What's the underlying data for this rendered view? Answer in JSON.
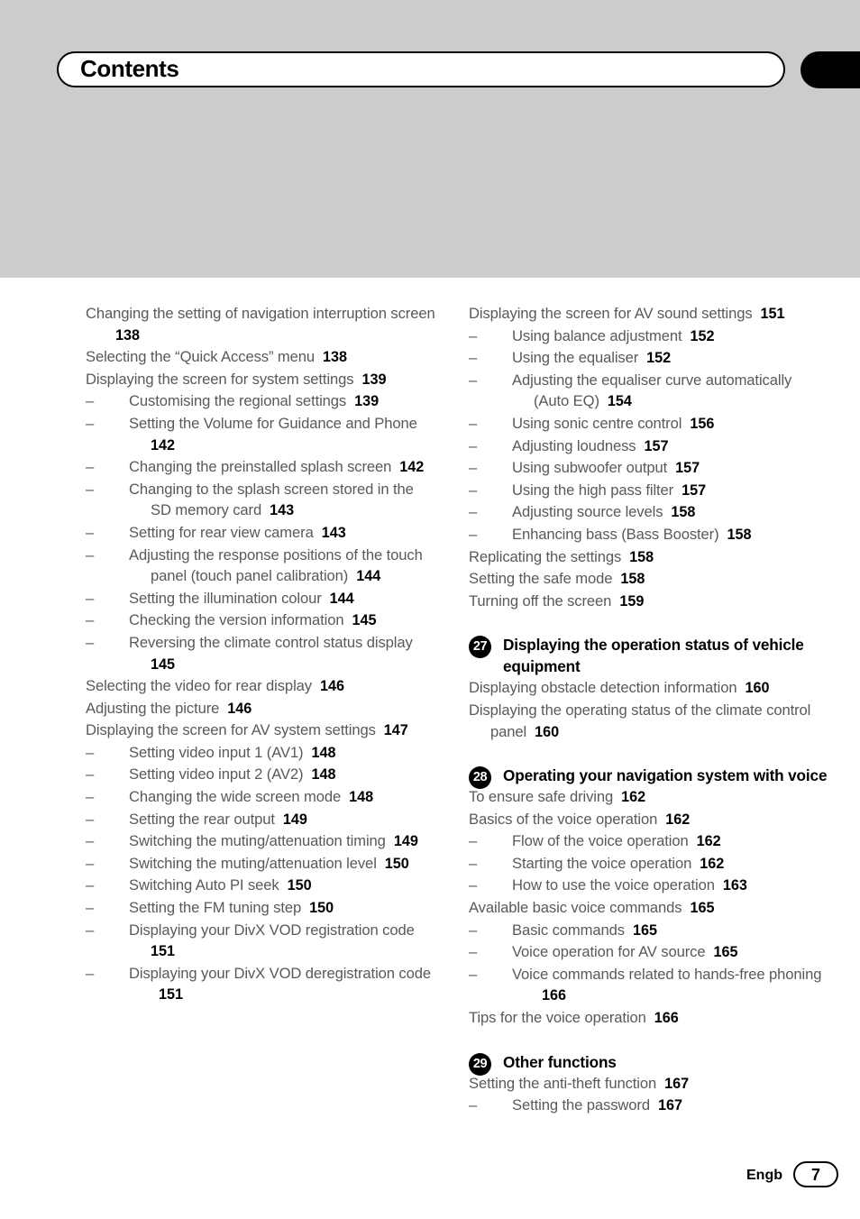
{
  "header": {
    "title": "Contents",
    "tab_icon": "black-edge-tab"
  },
  "footer": {
    "language_code": "Engb",
    "page_number": "7"
  },
  "columns": {
    "left": [
      {
        "level": 1,
        "text": "Changing the setting of navigation interruption screen",
        "page": "138"
      },
      {
        "level": 1,
        "text": "Selecting the “Quick Access” menu",
        "page": "138"
      },
      {
        "level": 1,
        "text": "Displaying the screen for system settings",
        "page": "139"
      },
      {
        "level": 2,
        "text": "Customising the regional settings",
        "page": "139"
      },
      {
        "level": 2,
        "text": "Setting the Volume for Guidance and Phone",
        "page": "142"
      },
      {
        "level": 2,
        "text": "Changing the preinstalled splash screen",
        "page": "142"
      },
      {
        "level": 2,
        "text": "Changing to the splash screen stored in the SD memory card",
        "page": "143"
      },
      {
        "level": 2,
        "text": "Setting for rear view camera",
        "page": "143"
      },
      {
        "level": 2,
        "text": "Adjusting the response positions of the touch panel (touch panel calibration)",
        "page": "144"
      },
      {
        "level": 2,
        "text": "Setting the illumination colour",
        "page": "144"
      },
      {
        "level": 2,
        "text": "Checking the version information",
        "page": "145"
      },
      {
        "level": 2,
        "text": "Reversing the climate control status display",
        "page": "145"
      },
      {
        "level": 1,
        "text": "Selecting the video for rear display",
        "page": "146"
      },
      {
        "level": 1,
        "text": "Adjusting the picture",
        "page": "146"
      },
      {
        "level": 1,
        "text": "Displaying the screen for AV system settings",
        "page": "147"
      },
      {
        "level": 2,
        "text": "Setting video input 1 (AV1)",
        "page": "148"
      },
      {
        "level": 2,
        "text": "Setting video input 2 (AV2)",
        "page": "148"
      },
      {
        "level": 2,
        "text": "Changing the wide screen mode",
        "page": "148"
      },
      {
        "level": 2,
        "text": "Setting the rear output",
        "page": "149"
      },
      {
        "level": 2,
        "text": "Switching the muting/attenuation timing",
        "page": "149"
      },
      {
        "level": 2,
        "text": "Switching the muting/attenuation level",
        "page": "150"
      },
      {
        "level": 2,
        "text": "Switching Auto PI seek",
        "page": "150"
      },
      {
        "level": 2,
        "text": "Setting the FM tuning step",
        "page": "150"
      },
      {
        "level": 2,
        "text": "Displaying your DivX VOD registration code",
        "page": "151"
      },
      {
        "level": 2,
        "text": "Displaying your DivX VOD deregistration code",
        "page": "151"
      }
    ],
    "right": [
      {
        "level": 1,
        "text": "Displaying the screen for AV sound settings",
        "page": "151"
      },
      {
        "level": 2,
        "text": "Using balance adjustment",
        "page": "152"
      },
      {
        "level": 2,
        "text": "Using the equaliser",
        "page": "152"
      },
      {
        "level": 2,
        "text": "Adjusting the equaliser curve automatically (Auto EQ)",
        "page": "154"
      },
      {
        "level": 2,
        "text": "Using sonic centre control",
        "page": "156"
      },
      {
        "level": 2,
        "text": "Adjusting loudness",
        "page": "157"
      },
      {
        "level": 2,
        "text": "Using subwoofer output",
        "page": "157"
      },
      {
        "level": 2,
        "text": "Using the high pass filter",
        "page": "157"
      },
      {
        "level": 2,
        "text": "Adjusting source levels",
        "page": "158"
      },
      {
        "level": 2,
        "text": "Enhancing bass (Bass Booster)",
        "page": "158"
      },
      {
        "level": 1,
        "text": "Replicating the settings",
        "page": "158"
      },
      {
        "level": 1,
        "text": "Setting the safe mode",
        "page": "158"
      },
      {
        "level": 1,
        "text": "Turning off the screen",
        "page": "159"
      },
      {
        "level": "chapter",
        "number": "27",
        "text": "Displaying the operation status of vehicle equipment"
      },
      {
        "level": 1,
        "text": "Displaying obstacle detection information",
        "page": "160"
      },
      {
        "level": 1,
        "text": "Displaying the operating status of the climate control panel",
        "page": "160"
      },
      {
        "level": "chapter",
        "number": "28",
        "text": "Operating your navigation system with voice"
      },
      {
        "level": 1,
        "text": "To ensure safe driving",
        "page": "162"
      },
      {
        "level": 1,
        "text": "Basics of the voice operation",
        "page": "162"
      },
      {
        "level": 2,
        "text": "Flow of the voice operation",
        "page": "162"
      },
      {
        "level": 2,
        "text": "Starting the voice operation",
        "page": "162"
      },
      {
        "level": 2,
        "text": "How to use the voice operation",
        "page": "163"
      },
      {
        "level": 1,
        "text": "Available basic voice commands",
        "page": "165"
      },
      {
        "level": 2,
        "text": "Basic commands",
        "page": "165"
      },
      {
        "level": 2,
        "text": "Voice operation for AV source",
        "page": "165"
      },
      {
        "level": 2,
        "text": "Voice commands related to hands-free phoning",
        "page": "166"
      },
      {
        "level": 1,
        "text": "Tips for the voice operation",
        "page": "166"
      },
      {
        "level": "chapter",
        "number": "29",
        "text": "Other functions"
      },
      {
        "level": 1,
        "text": "Setting the anti-theft function",
        "page": "167"
      },
      {
        "level": 2,
        "text": "Setting the password",
        "page": "167"
      }
    ]
  },
  "colors": {
    "header_band": "#cccccc",
    "body_text": "#58595b",
    "page_number_text": "#000000",
    "badge_background": "#000000"
  }
}
